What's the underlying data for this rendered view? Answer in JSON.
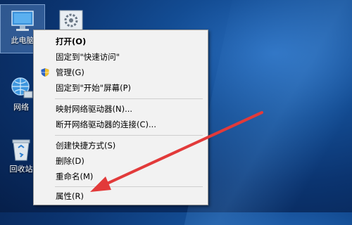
{
  "desktop": {
    "icons": [
      {
        "name": "此电脑",
        "id": "pc"
      },
      {
        "name": "网络",
        "id": "net"
      },
      {
        "name": "回收站",
        "id": "bin"
      }
    ]
  },
  "context_menu": {
    "items": [
      {
        "label": "打开(O)",
        "bold": true
      },
      {
        "label": "固定到\"快速访问\""
      },
      {
        "label": "管理(G)",
        "icon": "shield-icon"
      },
      {
        "label": "固定到\"开始\"屏幕(P)"
      },
      {
        "label": "映射网络驱动器(N)..."
      },
      {
        "label": "断开网络驱动器的连接(C)..."
      },
      {
        "label": "创建快捷方式(S)"
      },
      {
        "label": "删除(D)"
      },
      {
        "label": "重命名(M)"
      },
      {
        "label": "属性(R)"
      }
    ]
  },
  "colors": {
    "arrow": "#e23a3a",
    "menu_bg": "#f2f2f2",
    "desktop": "#0b3470"
  }
}
